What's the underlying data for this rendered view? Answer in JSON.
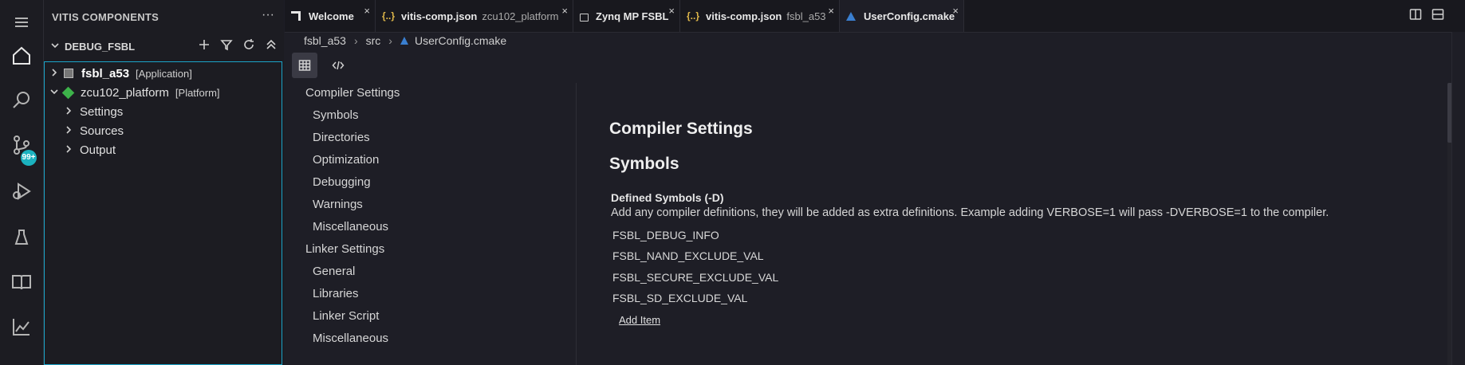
{
  "sidebar": {
    "title": "VITIS COMPONENTS",
    "more": "···",
    "section": "DEBUG_FSBL",
    "tree": [
      {
        "name": "fsbl_a53",
        "tag": "[Application]"
      },
      {
        "name": "zcu102_platform",
        "tag": "[Platform]"
      },
      {
        "name": "Settings"
      },
      {
        "name": "Sources"
      },
      {
        "name": "Output"
      }
    ]
  },
  "activity": {
    "badge": "99+"
  },
  "tabs": [
    {
      "title": "Welcome",
      "sub": ""
    },
    {
      "title": "vitis-comp.json",
      "sub": "zcu102_platform",
      "icon": "{..}"
    },
    {
      "title": "Zynq MP FSBL",
      "sub": ""
    },
    {
      "title": "vitis-comp.json",
      "sub": "fsbl_a53",
      "icon": "{..}"
    },
    {
      "title": "UserConfig.cmake",
      "sub": ""
    }
  ],
  "tab_close": "×",
  "breadcrumb": [
    "fsbl_a53",
    "src",
    "UserConfig.cmake"
  ],
  "breadcrumb_sep": "›",
  "nav": {
    "compiler": "Compiler Settings",
    "compiler_items": [
      "Symbols",
      "Directories",
      "Optimization",
      "Debugging",
      "Warnings",
      "Miscellaneous"
    ],
    "linker": "Linker Settings",
    "linker_items": [
      "General",
      "Libraries",
      "Linker Script",
      "Miscellaneous"
    ]
  },
  "content": {
    "h1": "Compiler Settings",
    "h2": "Symbols",
    "label": "Defined Symbols (-D)",
    "desc": "Add any compiler definitions, they will be added as extra definitions. Example adding VERBOSE=1 will pass -DVERBOSE=1 to the compiler.",
    "symbols": [
      "FSBL_DEBUG_INFO",
      "FSBL_NAND_EXCLUDE_VAL",
      "FSBL_SECURE_EXCLUDE_VAL",
      "FSBL_SD_EXCLUDE_VAL"
    ],
    "add_item": "Add Item"
  }
}
